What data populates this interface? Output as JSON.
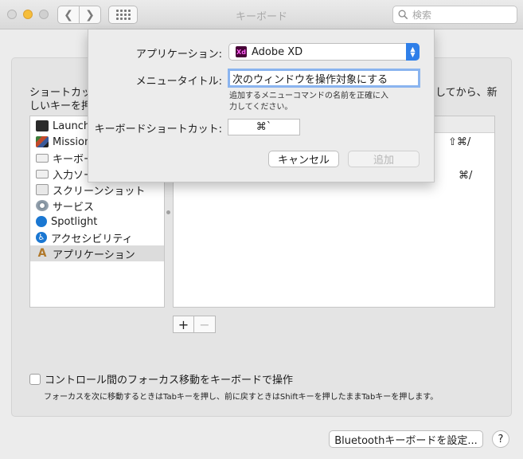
{
  "window": {
    "title": "キーボード"
  },
  "search": {
    "placeholder": "検索"
  },
  "instructions": {
    "left_line1": "ショートカッ",
    "left_line2": "しいキーを押",
    "right_line1": "してから、新"
  },
  "categories": [
    {
      "label": "Launchpad",
      "icon": "launchpad-icon"
    },
    {
      "label": "Mission Control",
      "icon": "mission-control-icon"
    },
    {
      "label": "キーボード",
      "icon": "keyboard-icon"
    },
    {
      "label": "入力ソース",
      "icon": "input-source-icon"
    },
    {
      "label": "スクリーンショット",
      "icon": "screenshot-icon"
    },
    {
      "label": "サービス",
      "icon": "gear-icon"
    },
    {
      "label": "Spotlight",
      "icon": "spotlight-icon"
    },
    {
      "label": "アクセシビリティ",
      "icon": "accessibility-icon"
    },
    {
      "label": "アプリケーション",
      "icon": "app-store-icon",
      "selected": true
    }
  ],
  "shortcuts": {
    "row1_keys": "⇧⌘/",
    "row2_keys": "⌘/"
  },
  "list_buttons": {
    "add": "+",
    "remove": "−"
  },
  "focus_option": {
    "label": "コントロール間のフォーカス移動をキーボードで操作",
    "checked": false,
    "note": "フォーカスを次に移動するときはTabキーを押し、前に戻すときはShiftキーを押したままTabキーを押します。"
  },
  "bottom": {
    "bluetooth_button": "Bluetoothキーボードを設定...",
    "help": "?"
  },
  "sheet": {
    "app_label": "アプリケーション:",
    "app_value": "Adobe XD",
    "app_icon_text": "Xd",
    "menu_title_label": "メニュータイトル:",
    "menu_title_value": "次のウィンドウを操作対象にする",
    "hint_line1": "追加するメニューコマンドの名前を正確に入",
    "hint_line2": "力してください。",
    "shortcut_label": "キーボードショートカット:",
    "shortcut_value": "⌘`",
    "cancel": "キャンセル",
    "add": "追加"
  },
  "colors": {
    "accent": "#2f7fe9",
    "focus_ring": "#8ab4ef",
    "xd_bg": "#470137",
    "xd_fg": "#ff61f6"
  }
}
